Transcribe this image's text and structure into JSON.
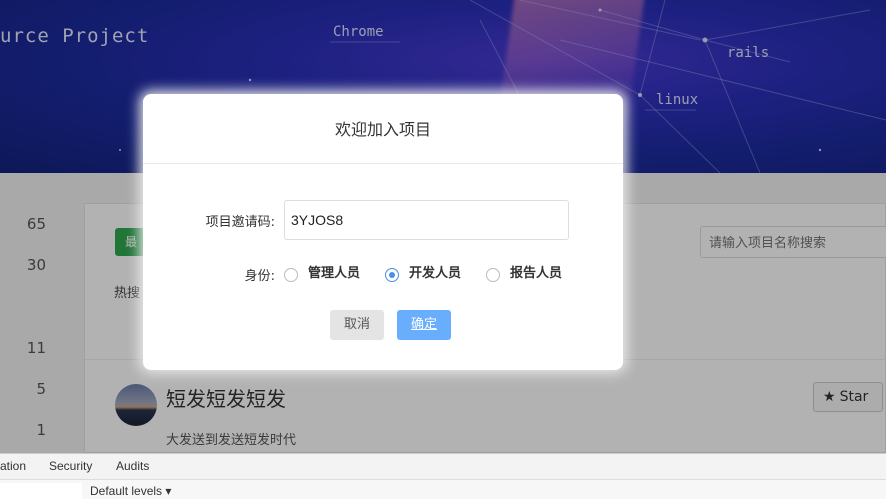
{
  "hero": {
    "title": "urce Project",
    "tags": [
      "Chrome",
      "rails",
      "linux"
    ]
  },
  "stats": [
    "65",
    "30",
    "11",
    "5",
    "1"
  ],
  "card": {
    "green_button_label": "最",
    "hot_label": "热搜",
    "search_placeholder": "请输入项目名称搜索",
    "project_title": "短发短发短发",
    "project_desc": "大发送到发送短发时代",
    "star_label": "Star"
  },
  "modal": {
    "title": "欢迎加入项目",
    "code_label": "项目邀请码:",
    "code_value": "3YJOS8",
    "role_label": "身份:",
    "roles": [
      {
        "label": "管理人员",
        "checked": false
      },
      {
        "label": "开发人员",
        "checked": true
      },
      {
        "label": "报告人员",
        "checked": false
      }
    ],
    "cancel_label": "取消",
    "ok_label": "确定",
    "accent_color": "#69aefc"
  },
  "devtools": {
    "tabs": [
      "ation",
      "Security",
      "Audits"
    ],
    "levels_label": "Default levels ▾"
  }
}
